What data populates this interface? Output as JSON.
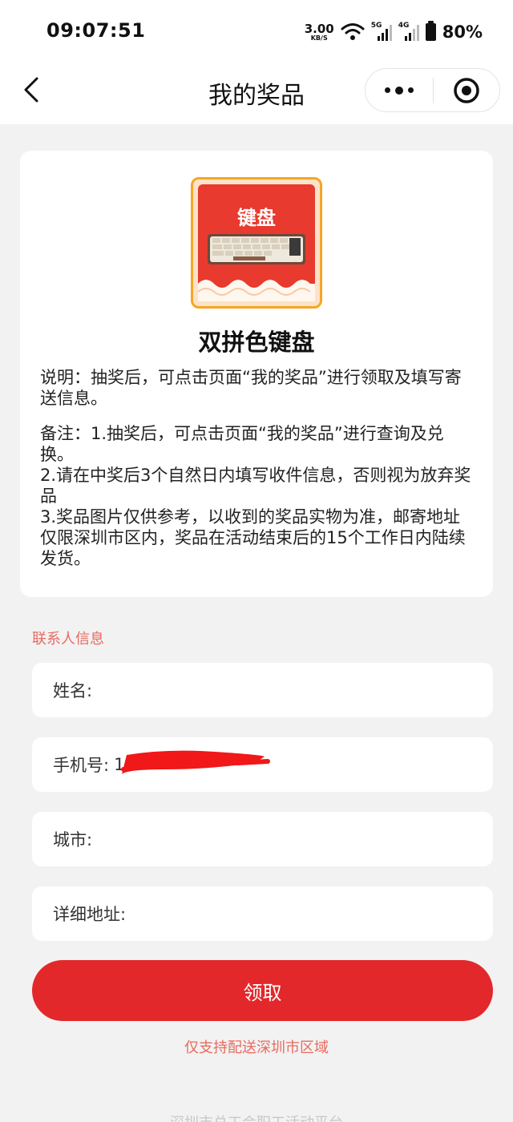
{
  "status_bar": {
    "time": "09:07:51",
    "net_speed_value": "3.00",
    "net_speed_unit": "KB/S",
    "sim1_tag": "5G",
    "sim2_tag": "4G",
    "battery": "80%"
  },
  "nav": {
    "title": "我的奖品"
  },
  "prize": {
    "image_label": "键盘",
    "title": "双拼色键盘",
    "description": "说明：抽奖后，可点击页面“我的奖品”进行领取及填写寄送信息。",
    "notes": [
      "备注：1.抽奖后，可点击页面“我的奖品”进行查询及兑换。",
      "2.请在中奖后3个自然日内填写收件信息，否则视为放弃奖品",
      "3.奖品图片仅供参考，以收到的奖品实物为准，邮寄地址仅限深圳市区内，奖品在活动结束后的15个工作日内陆续发货。"
    ]
  },
  "contact": {
    "section_label": "联系人信息",
    "name_label": "姓名:",
    "phone_label": "手机号:",
    "phone_value": "1",
    "city_label": "城市:",
    "address_label": "详细地址:"
  },
  "actions": {
    "claim_label": "领取",
    "support_note": "仅支持配送深圳市区域"
  },
  "footer": {
    "text": "深圳市总工会职工活动平台"
  },
  "colors": {
    "accent": "#e3282b",
    "hint": "#e86b5f",
    "background": "#f2f2f2"
  }
}
